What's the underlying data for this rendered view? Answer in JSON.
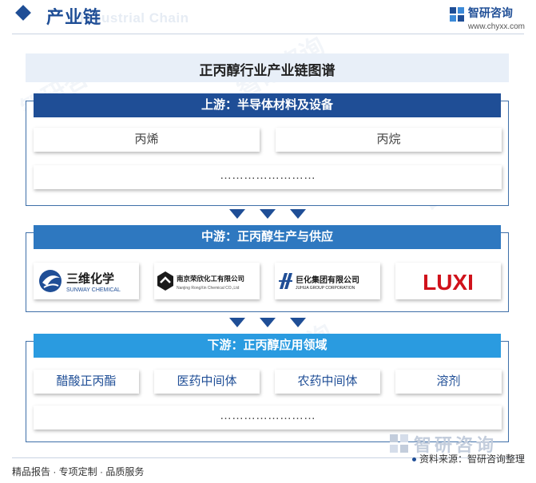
{
  "header": {
    "title": "产业链",
    "ghost_text": "Industrial Chain",
    "brand_name": "智研咨询",
    "brand_url": "www.chyxx.com"
  },
  "diagram": {
    "title": "正丙醇行业产业链图谱",
    "upstream": {
      "title": "上游：半导体材料及设备",
      "items": [
        "丙烯",
        "丙烷"
      ],
      "more": "……………………"
    },
    "midstream": {
      "title": "中游：正丙醇生产与供应",
      "companies": [
        {
          "name_cn": "三维化学",
          "name_en": "SUNWAY CHEMICAL",
          "icon": "sunway-logo"
        },
        {
          "name_cn": "南京荣欣化工有限公司",
          "name_en": "Nanjing RongXin Chemical CO.,Ltd",
          "icon": "rongxin-logo"
        },
        {
          "name_cn": "巨化集团有限公司",
          "name_en": "JUHUA GROUP CORPORATION",
          "icon": "juhua-logo"
        },
        {
          "name_cn": "LUXI",
          "name_en": "",
          "icon": "luxi-logo"
        }
      ]
    },
    "downstream": {
      "title": "下游：正丙醇应用领域",
      "items": [
        "醋酸正丙酯",
        "医药中间体",
        "农药中间体",
        "溶剂"
      ],
      "more": "……………………"
    }
  },
  "footer": {
    "left": "精品报告 · 专项定制 · 品质服务",
    "right": "资料来源：智研咨询整理",
    "brand": "智研咨询"
  },
  "colors": {
    "primary": "#1f4e96",
    "mid": "#2e78c0",
    "down": "#2a9be0",
    "luxi_red": "#d0121b"
  }
}
